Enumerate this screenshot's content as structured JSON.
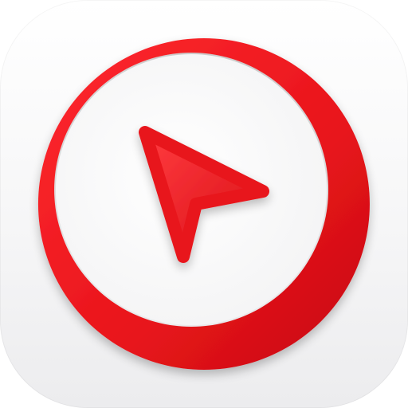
{
  "app_icon": {
    "icon": "compass-cursor-icon",
    "colors": {
      "background_top": "#ffffff",
      "background_bottom": "#ececee",
      "accent": "#e8141b",
      "accent_dark": "#c40c12",
      "accent_light": "#ff3b3f"
    }
  }
}
